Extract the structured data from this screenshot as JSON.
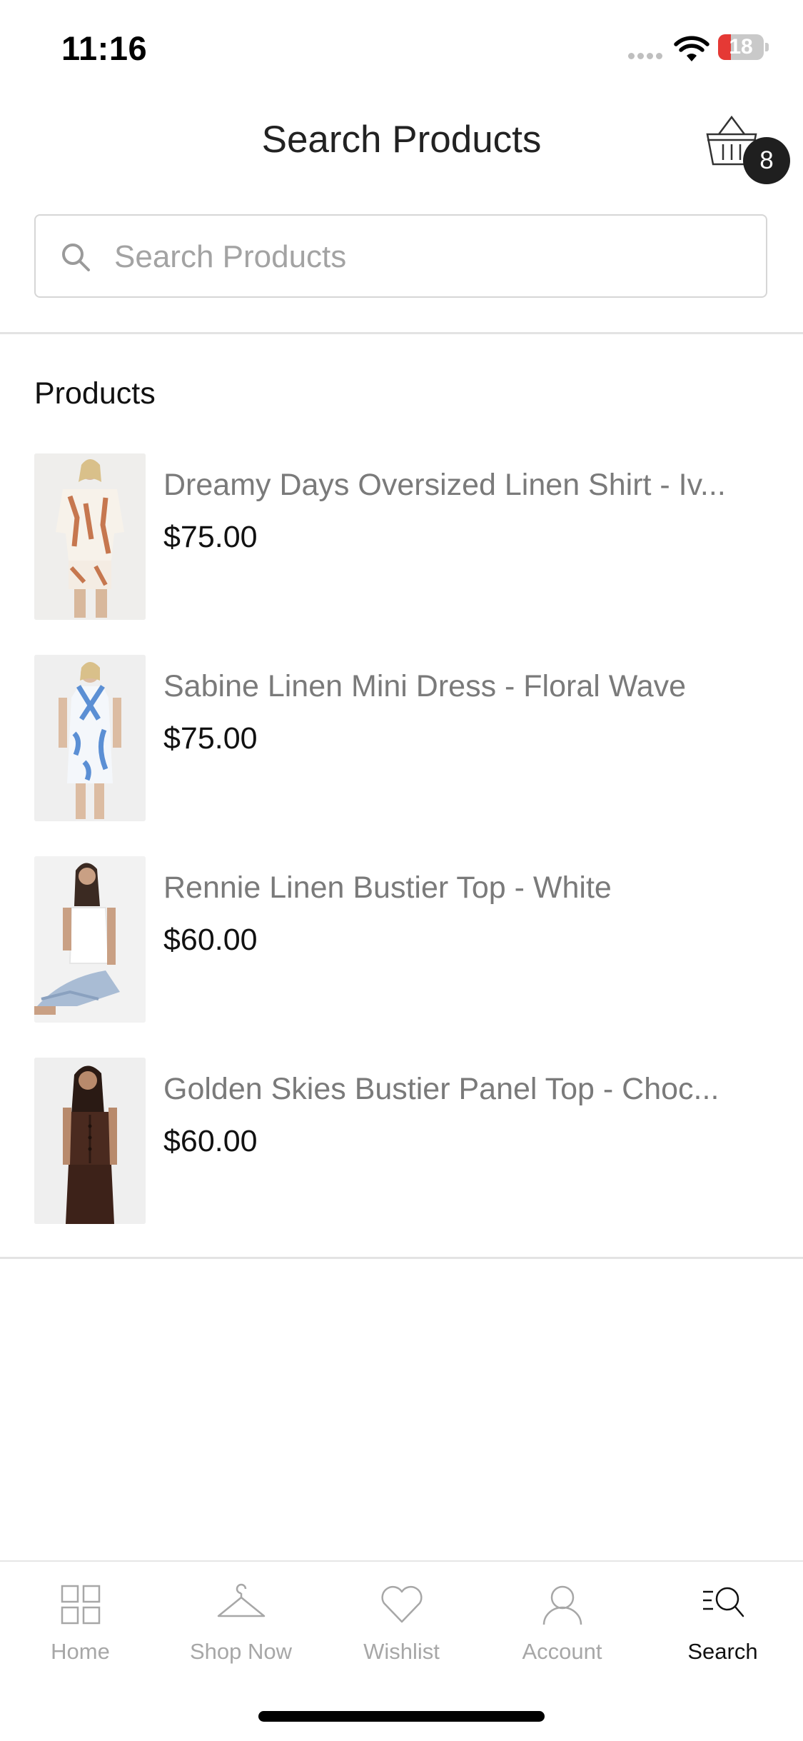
{
  "status_bar": {
    "time": "11:16",
    "battery_level": "18"
  },
  "header": {
    "title": "Search Products",
    "cart_count": "8"
  },
  "search": {
    "placeholder": "Search Products",
    "value": ""
  },
  "section": {
    "title": "Products"
  },
  "products": [
    {
      "name": "Dreamy Days Oversized Linen Shirt - Iv...",
      "price": "$75.00"
    },
    {
      "name": "Sabine Linen Mini Dress - Floral Wave",
      "price": "$75.00"
    },
    {
      "name": "Rennie Linen Bustier Top - White",
      "price": "$60.00"
    },
    {
      "name": "Golden Skies Bustier Panel Top - Choc...",
      "price": "$60.00"
    }
  ],
  "tabs": [
    {
      "label": "Home",
      "icon": "grid-icon",
      "active": false
    },
    {
      "label": "Shop Now",
      "icon": "hanger-icon",
      "active": false
    },
    {
      "label": "Wishlist",
      "icon": "heart-icon",
      "active": false
    },
    {
      "label": "Account",
      "icon": "person-icon",
      "active": false
    },
    {
      "label": "Search",
      "icon": "search-list-icon",
      "active": true
    }
  ],
  "colors": {
    "badge": "#1f1f1f",
    "battery_low": "#e53935",
    "inactive_tab": "#a7a7a7",
    "active_tab": "#111111"
  }
}
